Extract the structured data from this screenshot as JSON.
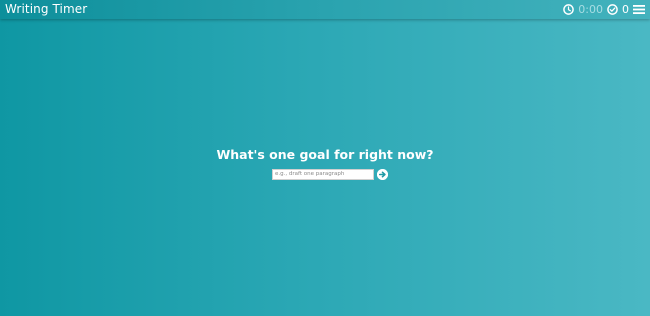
{
  "app": {
    "title": "Writing Timer"
  },
  "header": {
    "timer_value": "0:00",
    "tasks_completed": "0",
    "icons": [
      "clock-icon",
      "check-circle-icon",
      "hamburger-menu-icon"
    ]
  },
  "main": {
    "prompt": "What's one goal for right now?",
    "goal_input": {
      "value": "",
      "placeholder": "e.g., draft one paragraph"
    },
    "submit_icon": "arrow-right-circle-icon"
  },
  "colors": {
    "background_left": "#0f97a3",
    "background_right": "#4ab8c4",
    "text": "#ffffff",
    "timer_text": "#a7dde3"
  }
}
